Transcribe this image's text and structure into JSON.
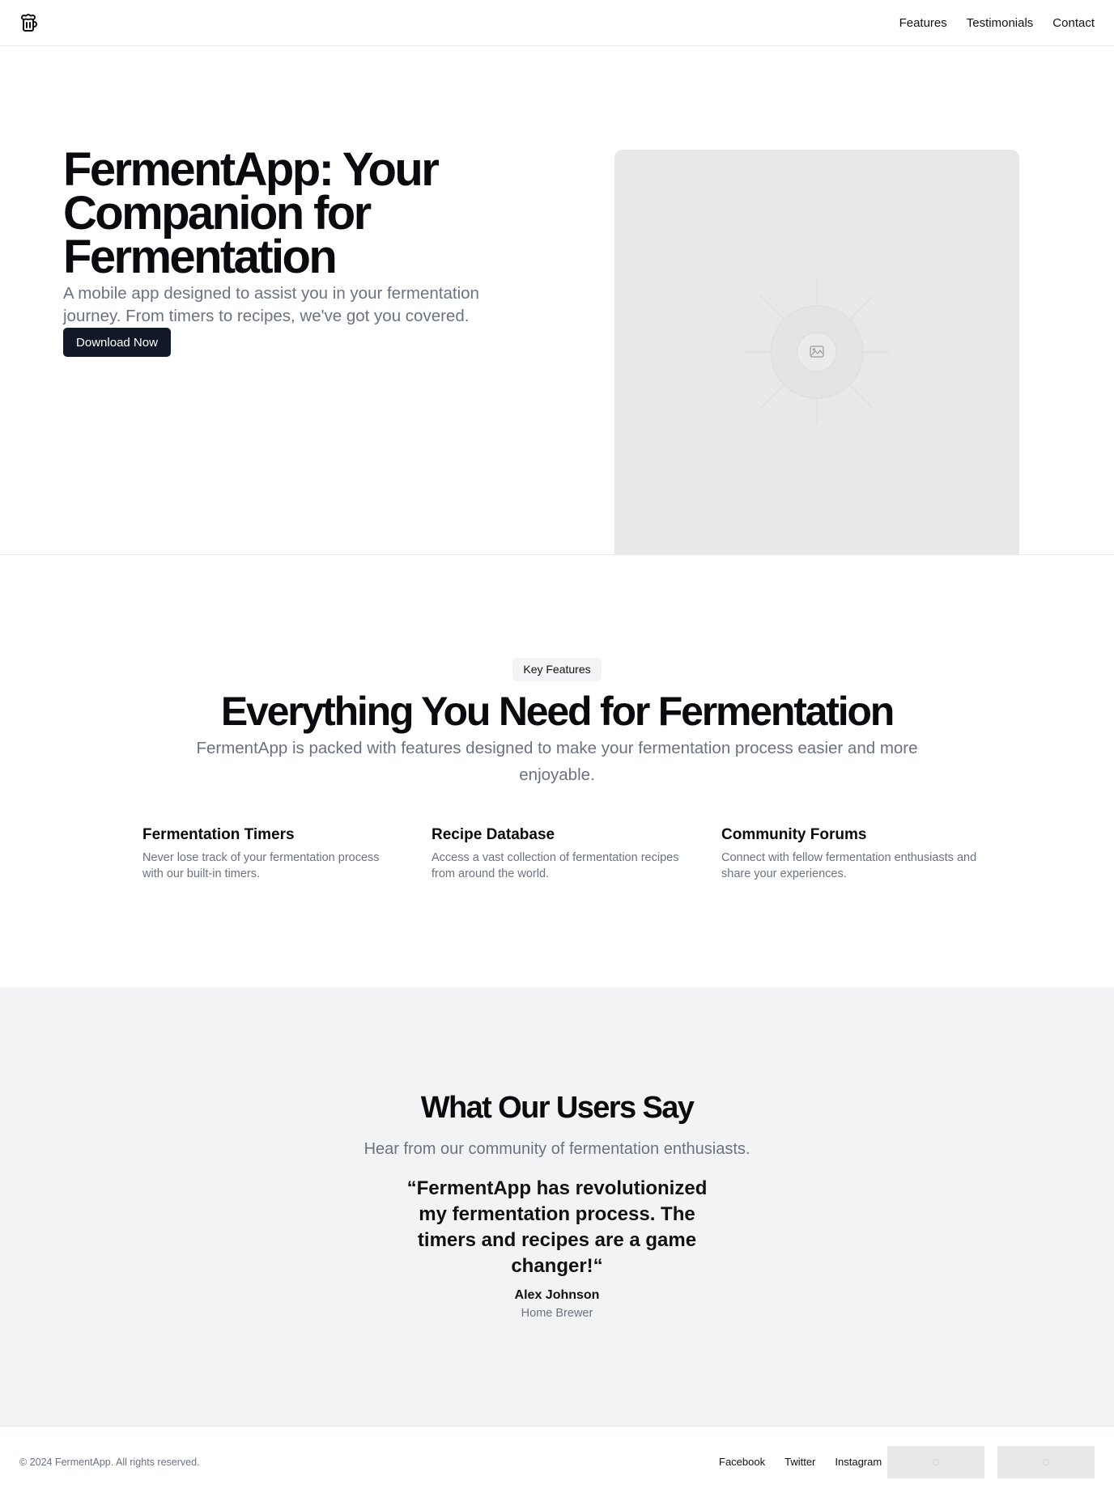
{
  "header": {
    "logo_icon": "beer-mug-icon",
    "nav": [
      "Features",
      "Testimonials",
      "Contact"
    ]
  },
  "hero": {
    "title": "FermentApp: Your Companion for Fermentation",
    "subtitle": "A mobile app designed to assist you in your fermentation journey. From timers to recipes, we've got you covered.",
    "cta_label": "Download Now",
    "image_icon": "image-placeholder-icon"
  },
  "features": {
    "badge": "Key Features",
    "title": "Everything You Need for Fermentation",
    "subtitle": "FermentApp is packed with features designed to make your fermentation process easier and more enjoyable.",
    "items": [
      {
        "title": "Fermentation Timers",
        "description": "Never lose track of your fermentation process with our built-in timers."
      },
      {
        "title": "Recipe Database",
        "description": "Access a vast collection of fermentation recipes from around the world."
      },
      {
        "title": "Community Forums",
        "description": "Connect with fellow fermentation enthusiasts and share your experiences."
      }
    ]
  },
  "testimonials": {
    "title": "What Our Users Say",
    "subtitle": "Hear from our community of fermentation enthusiasts.",
    "quote": "“FermentApp has revolutionized my fermentation process. The timers and recipes are a game changer!“",
    "author": "Alex Johnson",
    "role": "Home Brewer"
  },
  "footer": {
    "copyright": "© 2024 FermentApp. All rights reserved.",
    "links": [
      "Facebook",
      "Twitter",
      "Instagram"
    ]
  },
  "colors": {
    "primary_button": "#111827",
    "muted_text": "#6b7280",
    "section_bg": "#f2f3f5",
    "placeholder_bg": "#e8e8e8"
  }
}
